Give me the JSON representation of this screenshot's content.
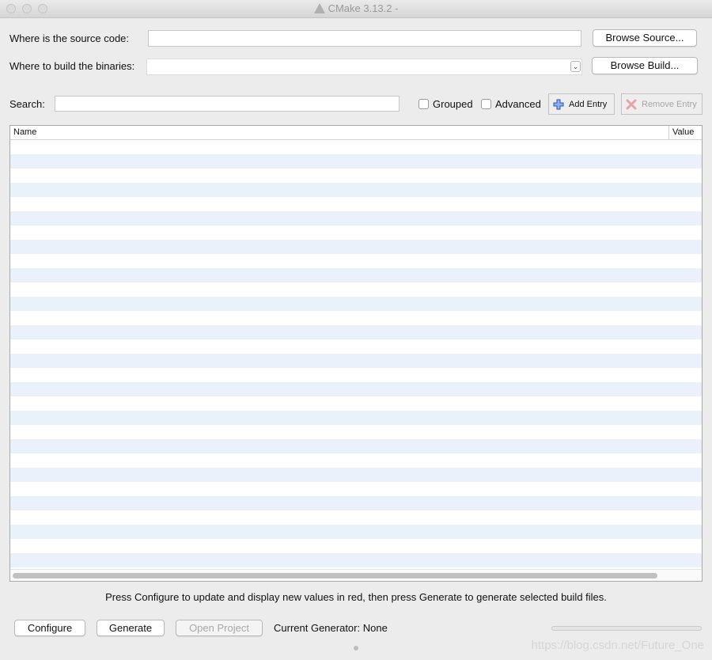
{
  "window": {
    "title": "CMake 3.13.2 -"
  },
  "source": {
    "label": "Where is the source code:",
    "value": "",
    "browse_label": "Browse Source..."
  },
  "build": {
    "label": "Where to build the binaries:",
    "value": "",
    "browse_label": "Browse Build..."
  },
  "search": {
    "label": "Search:",
    "value": ""
  },
  "options": {
    "grouped_label": "Grouped",
    "grouped_checked": false,
    "advanced_label": "Advanced",
    "advanced_checked": false
  },
  "toolbar": {
    "add_entry_label": "Add Entry",
    "remove_entry_label": "Remove Entry"
  },
  "table": {
    "columns": [
      "Name",
      "Value"
    ],
    "rows": []
  },
  "info_text": "Press Configure to update and display new values in red, then press Generate to generate selected build files.",
  "bottom": {
    "configure_label": "Configure",
    "generate_label": "Generate",
    "open_project_label": "Open Project",
    "current_generator_text": "Current Generator: None",
    "progress": 0
  },
  "watermark": "https://blog.csdn.net/Future_One",
  "icons": {
    "add": "plus-icon",
    "remove": "x-icon",
    "title": "cmake-logo-icon"
  },
  "colors": {
    "row_alt": "#ebf1fb",
    "add_icon": "#3a6fd0",
    "remove_icon": "#e6a5a5"
  }
}
